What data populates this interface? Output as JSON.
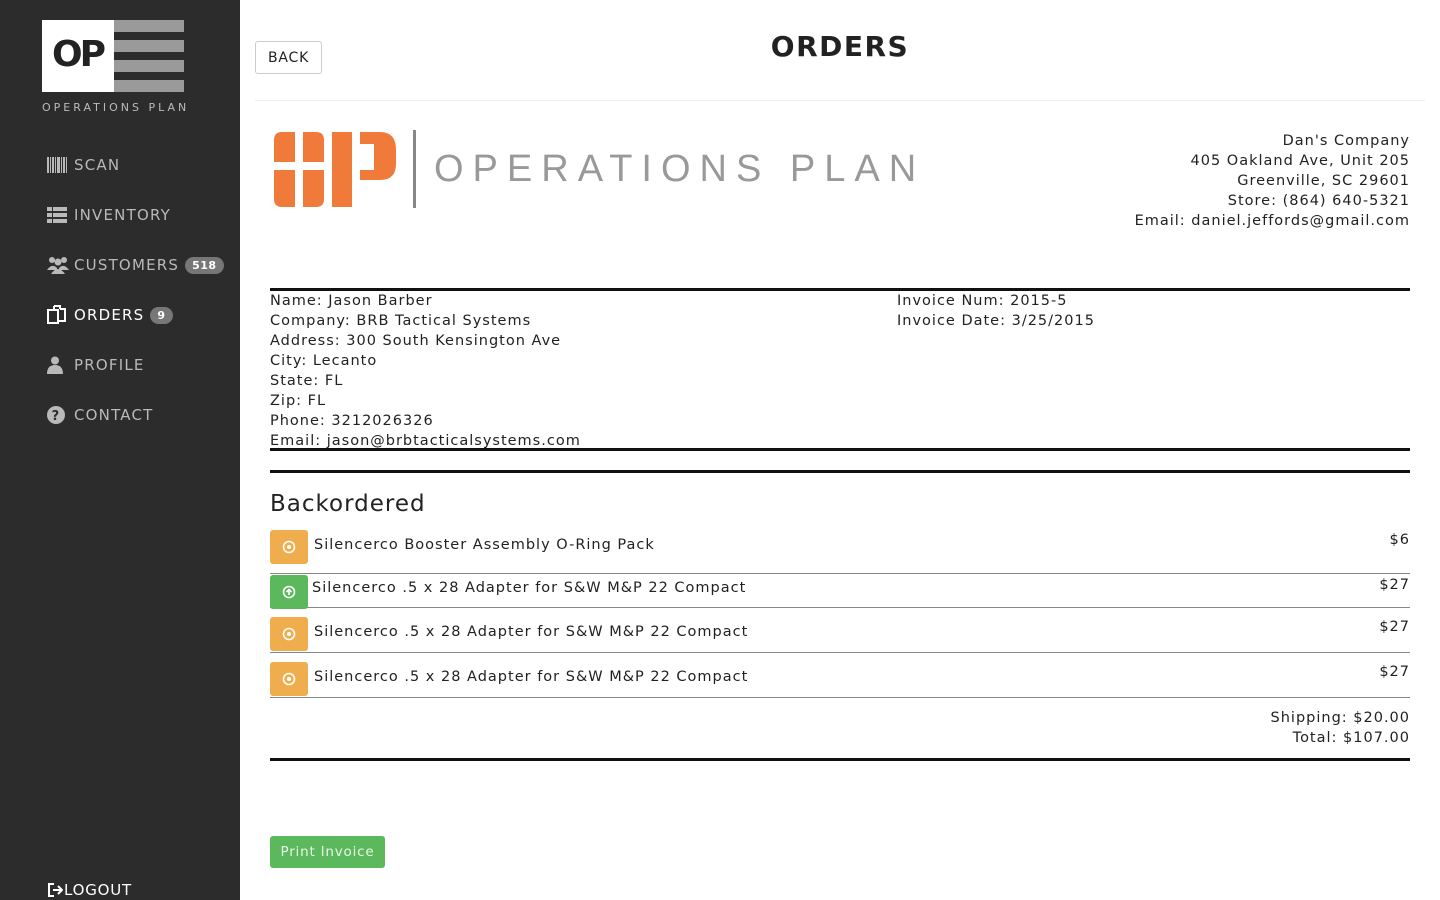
{
  "sidebar": {
    "logo": {
      "mark_text": "OP",
      "caption": "OPERATIONS PLAN"
    },
    "nav": [
      {
        "label": "SCAN",
        "icon": "barcode-icon"
      },
      {
        "label": "INVENTORY",
        "icon": "list-icon"
      },
      {
        "label": "CUSTOMERS",
        "icon": "users-icon",
        "badge": "518"
      },
      {
        "label": "ORDERS",
        "icon": "copy-icon",
        "badge": "9",
        "active": true
      },
      {
        "label": "PROFILE",
        "icon": "user-icon"
      },
      {
        "label": "CONTACT",
        "icon": "question-icon"
      }
    ],
    "logout_label": "LOGOUT"
  },
  "header": {
    "back_label": "BACK",
    "title": "ORDERS"
  },
  "invoice": {
    "brand": {
      "mark": "OP",
      "text": "OPERATIONS PLAN",
      "color": "#f07a3a"
    },
    "company": {
      "name": "Dan's Company",
      "address": "405 Oakland Ave, Unit 205",
      "city_state_zip": "Greenville, SC 29601",
      "store": "Store: (864) 640-5321",
      "email": "Email: daniel.jeffords@gmail.com"
    },
    "customer": {
      "name": "Name: Jason Barber",
      "company": "Company: BRB Tactical Systems",
      "address": "Address: 300 South Kensington Ave",
      "city": "City: Lecanto",
      "state": "State: FL",
      "zip": "Zip: FL",
      "phone": "Phone: 3212026326",
      "email": "Email: jason@brbtacticalsystems.com"
    },
    "meta": {
      "number": "Invoice Num: 2015-5",
      "date": "Invoice Date: 3/25/2015"
    },
    "section_title": "Backordered",
    "items": [
      {
        "name": "Silencerco Booster Assembly O-Ring Pack",
        "price": "$6",
        "status": "pending",
        "status_icon": "dot-circle-icon"
      },
      {
        "name": "Silencerco .5 x 28 Adapter for S&W M&P 22 Compact",
        "price": "$27",
        "status": "done",
        "status_icon": "arrow-up-circle-icon"
      },
      {
        "name": "Silencerco .5 x 28 Adapter for S&W M&P 22 Compact",
        "price": "$27",
        "status": "pending",
        "status_icon": "dot-circle-icon"
      },
      {
        "name": "Silencerco .5 x 28 Adapter for S&W M&P 22 Compact",
        "price": "$27",
        "status": "pending",
        "status_icon": "dot-circle-icon"
      }
    ],
    "shipping": "Shipping: $20.00",
    "total": "Total: $107.00"
  },
  "actions": {
    "print_label": "Print Invoice"
  },
  "colors": {
    "sidebar_bg": "#2c2c2c",
    "accent_orange": "#f07a3a",
    "status_pending": "#f0ad4e",
    "status_done": "#5cb85c"
  }
}
